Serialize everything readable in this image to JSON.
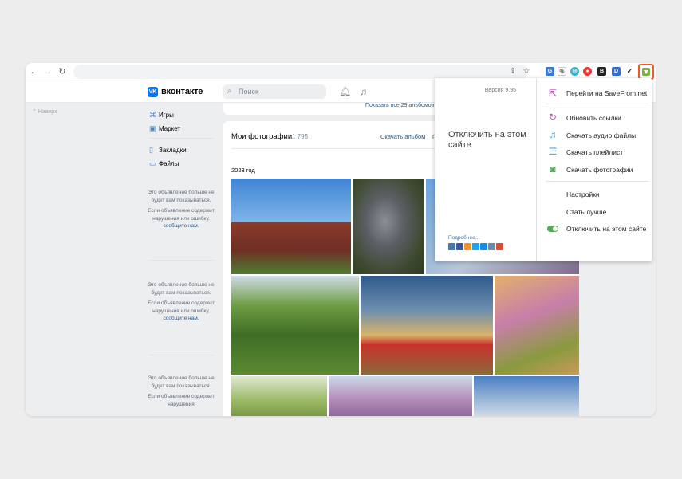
{
  "browser": {
    "icons": [
      "back-icon",
      "forward-icon",
      "reload-icon",
      "share-icon",
      "star-icon",
      "puzzle-icon"
    ]
  },
  "vk": {
    "logo_text": "VK",
    "brand": "вконтакте",
    "search_placeholder": "Поиск"
  },
  "sidebar": {
    "nav_up": "Наверх",
    "items": [
      {
        "label": "Игры",
        "icon": "gamepad-icon"
      },
      {
        "label": "Маркет",
        "icon": "shopping-bag-icon"
      },
      {
        "label": "Закладки",
        "icon": "bookmark-icon"
      },
      {
        "label": "Файлы",
        "icon": "file-icon"
      }
    ],
    "ads": [
      {
        "hidden": "Это объявление больше не будет вам показываться.",
        "report_pre": "Если объявление содержит нарушения или ошибку,",
        "report_link": "сообщите нам."
      },
      {
        "hidden": "Это объявление больше не будет вам показываться.",
        "report_pre": "Если объявление содержит нарушения или ошибку,",
        "report_link": "сообщите нам."
      },
      {
        "hidden": "Это объявление больше не будет вам показываться.",
        "report_pre": "Если объявление содержит нарушения",
        "report_link": ""
      }
    ]
  },
  "content": {
    "show_albums": "Показать все 29 альбомов",
    "title": "Мои фотографии",
    "count": "1 795",
    "download_album": "Скачать альбом",
    "action_partial": "П",
    "year": "2023 год"
  },
  "popup": {
    "version": "Версия 9.95",
    "disable_title": "Отключить на этом сайте",
    "more": "Подробнее...",
    "socials": [
      "vk-icon",
      "facebook-icon",
      "odnoklassniki-icon",
      "twitter-icon",
      "moimir-icon",
      "livejournal-icon",
      "google-plus-icon"
    ],
    "menu": [
      {
        "label": "Перейти на SaveFrom.net",
        "icon": "external-link-icon",
        "color": "#c24fc2"
      },
      {
        "label": "Обновить ссылки",
        "icon": "refresh-icon",
        "color": "#c24fc2"
      },
      {
        "label": "Скачать аудио файлы",
        "icon": "music-note-icon",
        "color": "#29b6f6"
      },
      {
        "label": "Скачать плейлист",
        "icon": "playlist-icon",
        "color": "#29b6f6"
      },
      {
        "label": "Скачать фотографии",
        "icon": "camera-icon",
        "color": "#4caf50"
      }
    ],
    "settings": "Настройки",
    "improve": "Стать лучше",
    "disable_toggle": "Отключить на этом сайте"
  }
}
